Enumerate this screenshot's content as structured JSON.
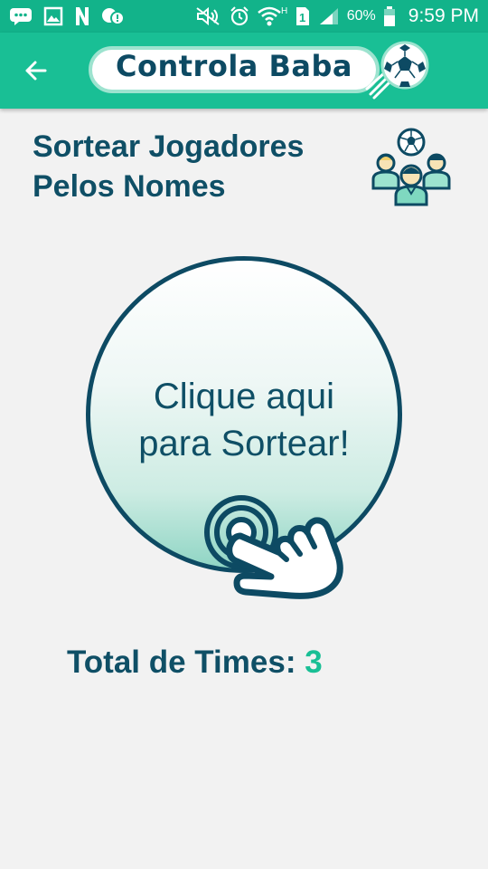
{
  "status_bar": {
    "battery": "60%",
    "time": "9:59 PM",
    "icons": [
      "chat-icon",
      "image-icon",
      "n-icon",
      "bubble-icon",
      "mute-icon",
      "alarm-icon",
      "wifi-icon",
      "sim-icon",
      "signal-icon",
      "battery-icon"
    ]
  },
  "app_bar": {
    "back_icon": "arrow-left-icon",
    "logo_text": "Controla Baba",
    "logo_icon": "soccer-ball-icon"
  },
  "page": {
    "title_line1": "Sortear Jogadores",
    "title_line2": "Pelos Nomes",
    "header_icon": "players-group-icon"
  },
  "draw_button": {
    "line1": "Clique aqui",
    "line2": "para Sortear!",
    "icon": "tap-hand-icon"
  },
  "total": {
    "label": "Total de Times: ",
    "value": "3"
  },
  "colors": {
    "primary": "#19bf95",
    "status_bar": "#12b38a",
    "text_dark": "#0f4f66",
    "background": "#f2f2f2"
  }
}
